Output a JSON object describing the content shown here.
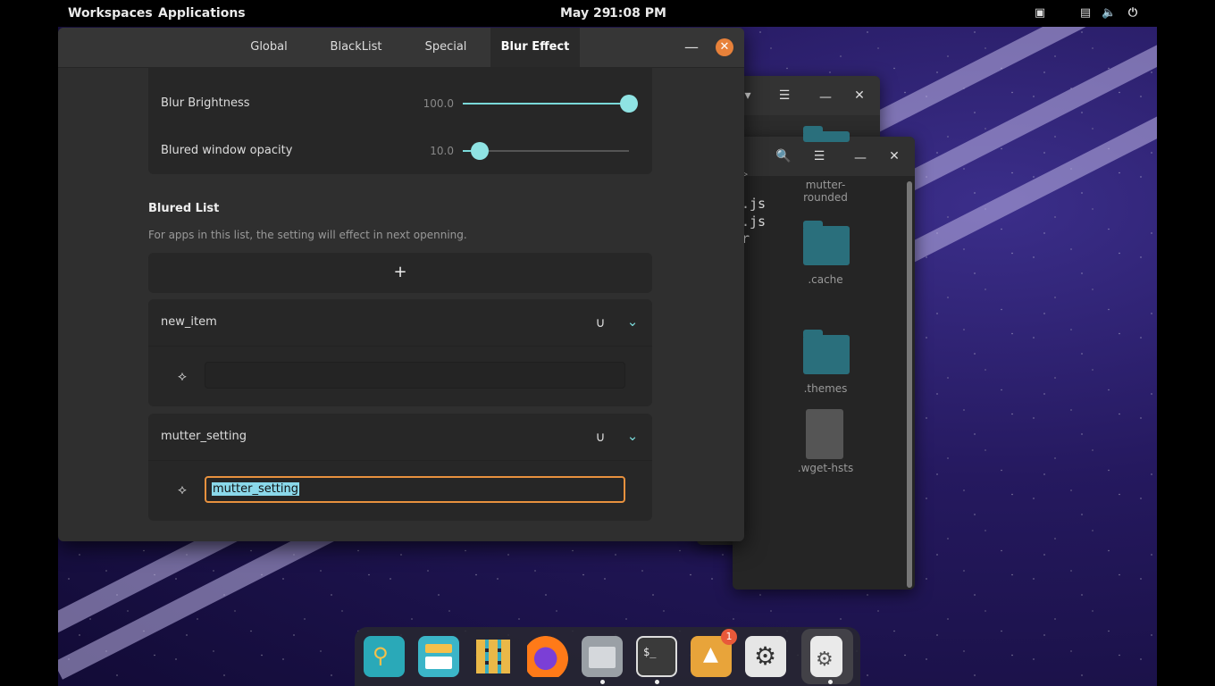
{
  "topbar": {
    "workspaces": "Workspaces",
    "applications": "Applications",
    "date": "May 29",
    "time": "1:08 PM"
  },
  "tabs": [
    {
      "label": "Global"
    },
    {
      "label": "BlackList"
    },
    {
      "label": "Special"
    },
    {
      "label": "Blur Effect",
      "active": true
    }
  ],
  "sliders": {
    "brightness": {
      "label": "Blur Brightness",
      "value": "100.0",
      "fraction": 1.0
    },
    "opacity": {
      "label": "Blured window opacity",
      "value": "10.0",
      "fraction": 0.1
    }
  },
  "blured_list": {
    "title": "Blured List",
    "description": "For apps in this list, the setting will effect in next openning.",
    "add_label": "+",
    "items": [
      {
        "name": "new_item",
        "entry_value": ""
      },
      {
        "name": "mutter_setting",
        "entry_value": "mutter_setting"
      }
    ]
  },
  "file_window": {
    "code_lines": [
      ".js",
      ".js",
      "r"
    ],
    "folders": [
      {
        "label": "mutter-\nrounded"
      },
      {
        "label": ".cache"
      },
      {
        "label": ".themes"
      },
      {
        "label": ".wget-hsts"
      }
    ]
  },
  "dock": {
    "badge": "1",
    "terminal_prompt": "$_"
  },
  "colors": {
    "accent": "#e7813a",
    "slider": "#8fe3e3",
    "selection": "#8ad8ea"
  }
}
